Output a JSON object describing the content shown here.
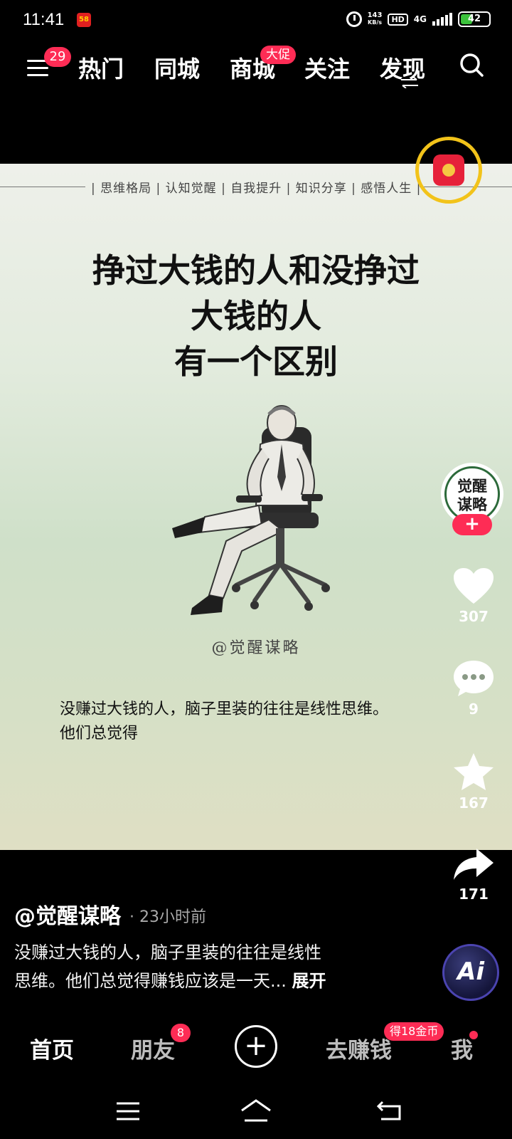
{
  "status_bar": {
    "time": "11:41",
    "notification_app": "58",
    "net_speed_value": "143",
    "net_speed_unit": "KB/s",
    "hd": "HD",
    "network": "4G",
    "battery": "42",
    "battery_level": 0.42
  },
  "top_nav": {
    "menu_badge": "29",
    "tabs": [
      {
        "label": "热门"
      },
      {
        "label": "同城"
      },
      {
        "label": "商城",
        "badge": "大促"
      },
      {
        "label": "关注"
      },
      {
        "label": "发现"
      }
    ]
  },
  "post_image": {
    "tags": "| 思维格局 | 认知觉醒 | 自我提升 | 知识分享 | 感悟人生 |",
    "title_lines": [
      "挣过大钱的人和没挣过",
      "大钱的人",
      "有一个区别"
    ],
    "credit": "@觉醒谋略",
    "body_lines": [
      "没赚过大钱的人，脑子里装的往往是线性思维。",
      "他们总觉得"
    ]
  },
  "actions": {
    "avatar_text_1": "觉醒",
    "avatar_text_2": "谋略",
    "follow": "+",
    "likes": "307",
    "comments": "9",
    "favorites": "167",
    "shares": "171"
  },
  "post": {
    "author": "@觉醒谋略",
    "time": "· 23小时前",
    "caption_line1": "没赚过大钱的人，脑子里装的往往是线性",
    "caption_line2": "思维。他们总觉得赚钱应该是一天...",
    "expand": "展开",
    "ai_label": "Ai"
  },
  "bottom_bar": {
    "home": "首页",
    "friends": "朋友",
    "friends_badge": "8",
    "create": "+",
    "earn": "去赚钱",
    "earn_badge": "得18金币",
    "me": "我"
  }
}
